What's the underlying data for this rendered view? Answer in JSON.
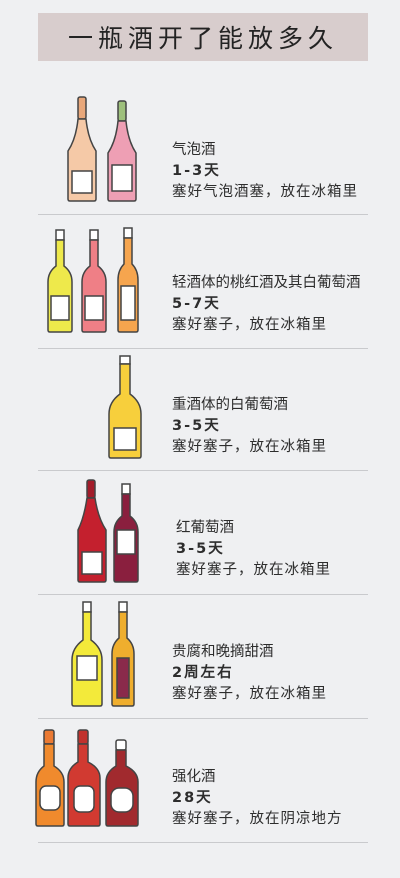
{
  "title": "一瓶酒开了能放多久",
  "entries": [
    {
      "name": "气泡酒",
      "duration": "1-3天",
      "advice": "塞好气泡酒塞，放在冰箱里",
      "bottles": [
        "sparkling-rose-bottle-icon",
        "sparkling-pink-bottle-icon"
      ]
    },
    {
      "name": "轻酒体的桃红酒及其白葡萄酒",
      "duration": "5-7天",
      "advice": "塞好塞子，放在冰箱里",
      "bottles": [
        "yellow-wine-bottle-icon",
        "pink-wine-bottle-icon",
        "orange-wine-bottle-icon"
      ]
    },
    {
      "name": "重酒体的白葡萄酒",
      "duration": "3-5天",
      "advice": "塞好塞子，放在冰箱里",
      "bottles": [
        "gold-wine-bottle-icon"
      ]
    },
    {
      "name": "红葡萄酒",
      "duration": "3-5天",
      "advice": "塞好塞子，放在冰箱里",
      "bottles": [
        "red-wine-bottle-icon",
        "purple-wine-bottle-icon"
      ]
    },
    {
      "name": "贵腐和晚摘甜酒",
      "duration": "2周左右",
      "advice": "塞好塞子，放在冰箱里",
      "bottles": [
        "yellow-sweet-wine-bottle-icon",
        "amber-sweet-wine-bottle-icon"
      ]
    },
    {
      "name": "强化酒",
      "duration": "28天",
      "advice": "塞好塞子，放在阴凉地方",
      "bottles": [
        "orange-fortified-bottle-icon",
        "red-fortified-bottle-icon",
        "brown-fortified-bottle-icon"
      ]
    }
  ],
  "colors": {
    "background": "#eff0f2",
    "title_band": "#d8cdcd",
    "divider": "#c9cacd"
  }
}
